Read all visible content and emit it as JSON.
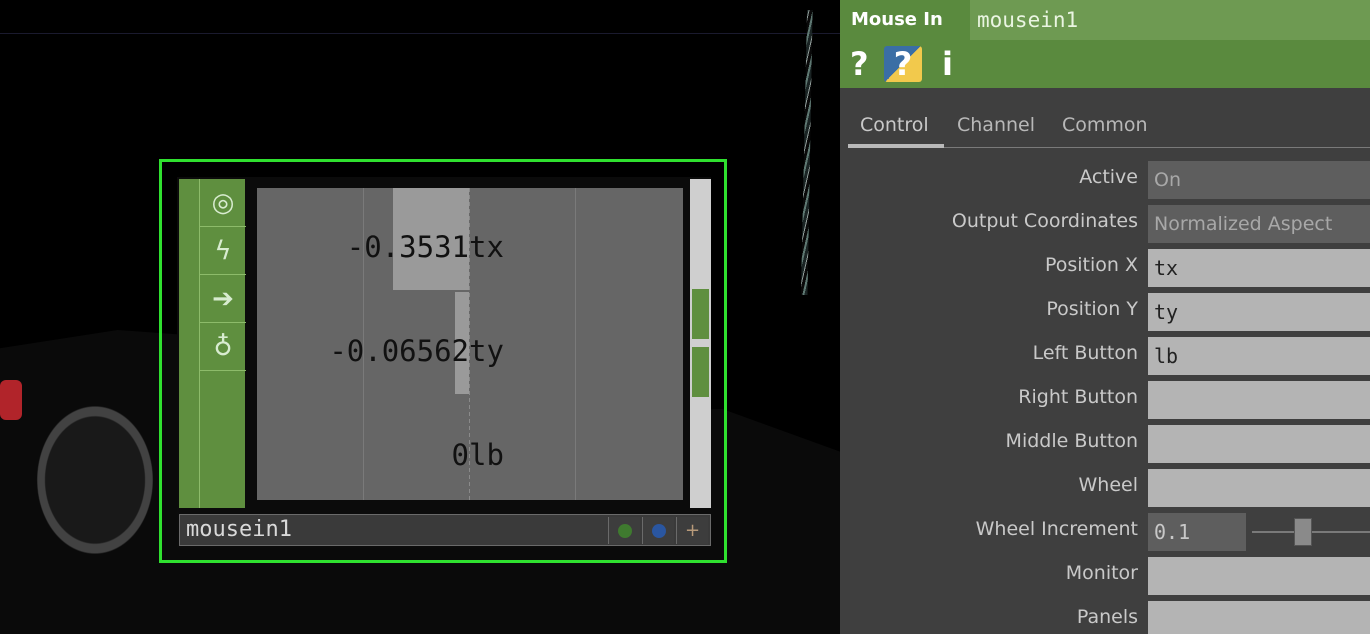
{
  "viewport": {
    "node": {
      "name": "mousein1",
      "side_icons": [
        "target-icon",
        "lightning-icon",
        "arrow-right-icon",
        "lock-icon"
      ],
      "channels": [
        {
          "value": "-0.3531",
          "name": "tx"
        },
        {
          "value": "-0.06562",
          "name": "ty"
        },
        {
          "value": "0",
          "name": "lb"
        }
      ]
    }
  },
  "panel": {
    "op_type": "Mouse In",
    "op_name": "mousein1",
    "header_icons": {
      "help": "?",
      "python_help": "?",
      "info": "i"
    },
    "tabs": [
      "Control",
      "Channel",
      "Common"
    ],
    "active_tab": "Control",
    "params": [
      {
        "label": "Active",
        "value": "On"
      },
      {
        "label": "Output Coordinates",
        "value": "Normalized Aspect"
      },
      {
        "label": "Position X",
        "value": "tx"
      },
      {
        "label": "Position Y",
        "value": "ty"
      },
      {
        "label": "Left Button",
        "value": "lb"
      },
      {
        "label": "Right Button",
        "value": ""
      },
      {
        "label": "Middle Button",
        "value": ""
      },
      {
        "label": "Wheel",
        "value": ""
      },
      {
        "label": "Wheel Increment",
        "value": "0.1"
      },
      {
        "label": "Monitor",
        "value": ""
      },
      {
        "label": "Panels",
        "value": ""
      }
    ]
  },
  "colors": {
    "node_border": "#2fe02f",
    "header_green": "#5a8a3e"
  }
}
